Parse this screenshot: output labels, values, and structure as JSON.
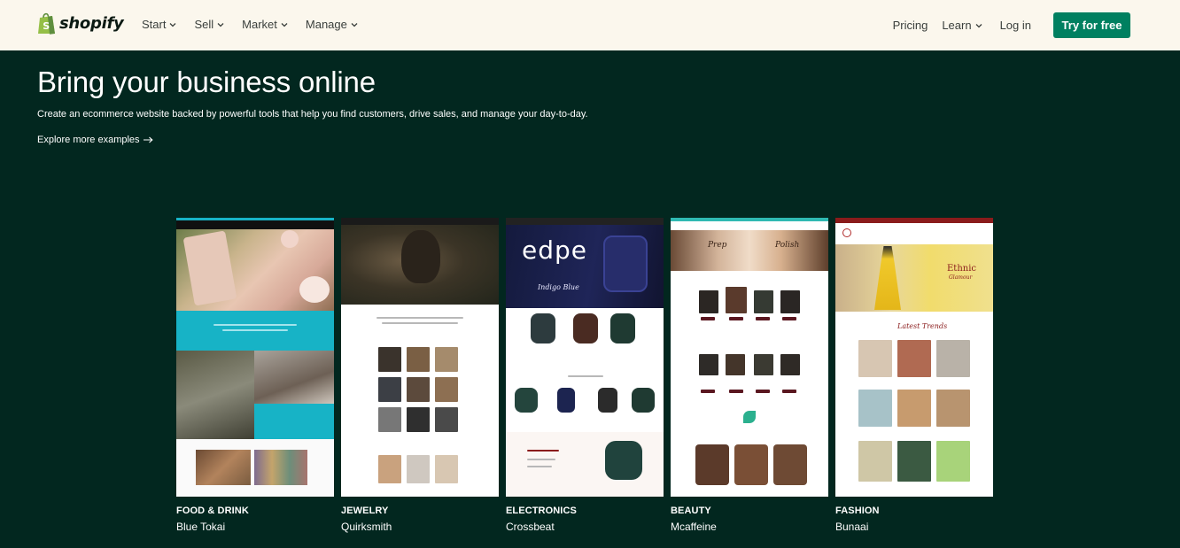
{
  "header": {
    "logo_text": "shopify",
    "nav_left": [
      {
        "label": "Start"
      },
      {
        "label": "Sell"
      },
      {
        "label": "Market"
      },
      {
        "label": "Manage"
      }
    ],
    "pricing": "Pricing",
    "learn": "Learn",
    "login": "Log in",
    "cta": "Try for free"
  },
  "hero": {
    "title": "Bring your business online",
    "subtitle": "Create an ecommerce website backed by powerful tools that help you find customers, drive sales, and manage your day-to-day.",
    "explore": "Explore more examples"
  },
  "examples": [
    {
      "category": "FOOD & DRINK",
      "store": "Blue Tokai"
    },
    {
      "category": "JEWELRY",
      "store": "Quirksmith"
    },
    {
      "category": "ELECTRONICS",
      "store": "Crossbeat"
    },
    {
      "category": "BEAUTY",
      "store": "Mcaffeine"
    },
    {
      "category": "FASHION",
      "store": "Bunaai"
    }
  ],
  "thumb_text": {
    "crossbeat_brand": "edpe",
    "crossbeat_tagline": "Indigo Blue",
    "bunaai_banner": "Ethnic",
    "bunaai_banner2": "Glamour",
    "bunaai_section": "Latest Trends",
    "mcaffeine_left": "Prep",
    "mcaffeine_right": "Polish"
  },
  "colors": {
    "header_bg": "#fbf7ed",
    "hero_bg": "#02271f",
    "cta_bg": "#008060",
    "bluetokai_teal": "#17b3c6",
    "crossbeat_dark": "#13163a",
    "bunaai_red": "#8a1b1b",
    "mcaffeine_maroon": "#5a1720"
  }
}
